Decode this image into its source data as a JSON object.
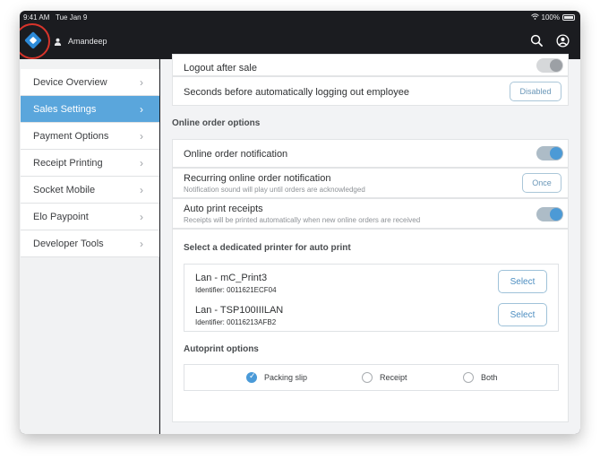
{
  "status_bar": {
    "time": "9:41 AM",
    "date": "Tue Jan 9",
    "battery": "100%"
  },
  "header": {
    "user_name": "Amandeep"
  },
  "sidebar": {
    "items": [
      {
        "label": "Device Overview"
      },
      {
        "label": "Sales Settings"
      },
      {
        "label": "Payment Options"
      },
      {
        "label": "Receipt Printing"
      },
      {
        "label": "Socket Mobile"
      },
      {
        "label": "Elo Paypoint"
      },
      {
        "label": "Developer Tools"
      }
    ],
    "active_label": "Sales Settings"
  },
  "settings": {
    "logout_after_sale": {
      "label": "Logout after sale",
      "enabled": false
    },
    "seconds_before_logout": {
      "label": "Seconds before automatically logging out employee",
      "value": "Disabled"
    }
  },
  "online_order_options": {
    "heading": "Online order options",
    "notification": {
      "label": "Online order notification",
      "enabled": true
    },
    "recurring_notification": {
      "label": "Recurring online order notification",
      "sub": "Notification sound will play until orders are acknowledged",
      "value": "Once"
    },
    "auto_print": {
      "label": "Auto print receipts",
      "sub": "Receipts will be printed automatically when new online orders are received",
      "enabled": true
    }
  },
  "printer_section": {
    "heading": "Select a dedicated printer for auto print",
    "printers": [
      {
        "name": "Lan - mC_Print3",
        "identifier": "Identifier: 0011621ECF04",
        "button": "Select"
      },
      {
        "name": "Lan - TSP100IIILAN",
        "identifier": "Identifier: 00116213AFB2",
        "button": "Select"
      }
    ]
  },
  "autoprint_options": {
    "heading": "Autoprint options",
    "options": [
      {
        "label": "Packing slip",
        "checked": true
      },
      {
        "label": "Receipt",
        "checked": false
      },
      {
        "label": "Both",
        "checked": false
      }
    ]
  },
  "colors": {
    "accent": "#5aa6dc",
    "toggle_on": "#4c9ad6",
    "header_bg": "#1b1c20"
  },
  "icons": {
    "logo": "app-logo-icon",
    "search": "search-icon",
    "account": "account-icon",
    "user": "user-icon"
  }
}
